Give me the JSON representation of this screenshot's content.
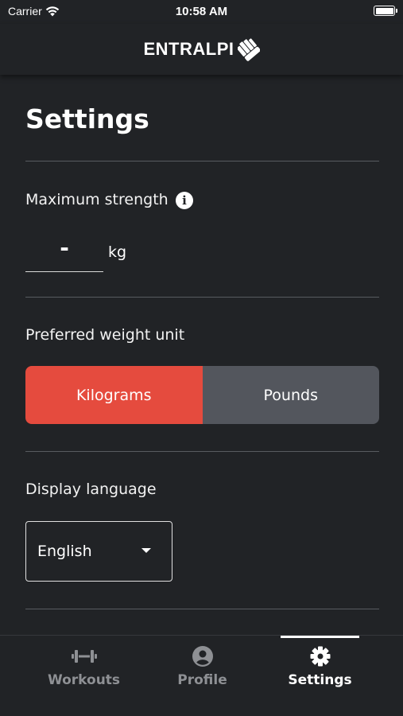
{
  "status_bar": {
    "carrier": "Carrier",
    "time": "10:58 AM"
  },
  "header": {
    "logo_text": "ENTRALPI"
  },
  "page": {
    "title": "Settings"
  },
  "max_strength": {
    "label": "Maximum strength",
    "value": "-",
    "unit": "kg"
  },
  "weight_unit": {
    "label": "Preferred weight unit",
    "options": [
      "Kilograms",
      "Pounds"
    ],
    "selected": "Kilograms"
  },
  "language": {
    "label": "Display language",
    "value": "English"
  },
  "tabs": [
    {
      "label": "Workouts",
      "icon": "dumbbell-icon"
    },
    {
      "label": "Profile",
      "icon": "profile-icon"
    },
    {
      "label": "Settings",
      "icon": "gear-icon"
    }
  ],
  "colors": {
    "background": "#212326",
    "accent": "#e54b3e",
    "segment_inactive": "#53565d"
  }
}
